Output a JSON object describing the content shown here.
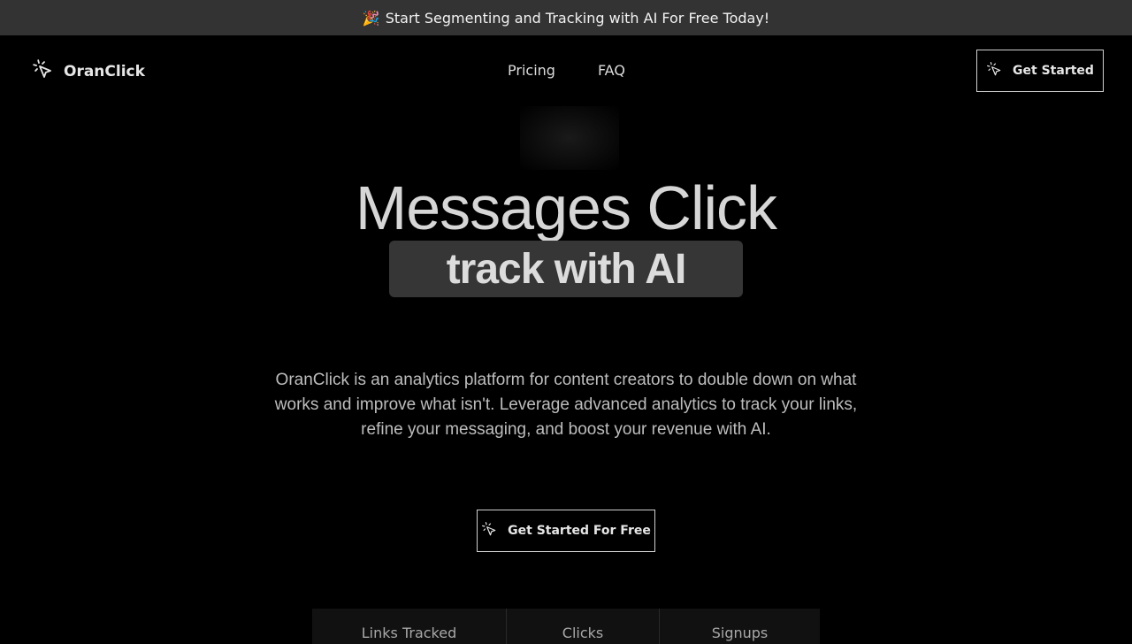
{
  "banner": {
    "emoji": "🎉",
    "text": "Start Segmenting and Tracking with AI For Free Today!"
  },
  "nav": {
    "brand": "OranClick",
    "links": [
      "Pricing",
      "FAQ"
    ],
    "cta_label": "Get Started"
  },
  "hero": {
    "title": "Messages Click",
    "highlight": "track with AI",
    "description": "OranClick is an analytics platform for content creators to double down on what works and improve what isn't. Leverage advanced analytics to track your links, refine your messaging, and boost your revenue with AI.",
    "cta_label": "Get Started For Free"
  },
  "stats": [
    "Links Tracked",
    "Clicks",
    "Signups"
  ],
  "icons": {
    "logo": "cursor-click-icon",
    "button": "cursor-click-icon"
  },
  "colors": {
    "background": "#000000",
    "banner": "#333333",
    "pill": "#363636"
  }
}
